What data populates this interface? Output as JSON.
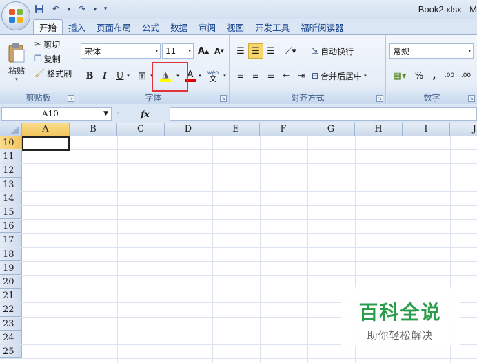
{
  "window": {
    "title": "Book2.xlsx - M"
  },
  "quick_access": {
    "save_icon": "save-icon",
    "undo_icon": "undo-icon",
    "redo_icon": "redo-icon",
    "customize": "▾"
  },
  "tabs": [
    {
      "label": "开始",
      "active": true
    },
    {
      "label": "插入"
    },
    {
      "label": "页面布局"
    },
    {
      "label": "公式"
    },
    {
      "label": "数据"
    },
    {
      "label": "审阅"
    },
    {
      "label": "视图"
    },
    {
      "label": "开发工具"
    },
    {
      "label": "福昕阅读器"
    }
  ],
  "clipboard": {
    "label": "剪贴板",
    "paste": "粘贴",
    "cut": "剪切",
    "copy": "复制",
    "format_painter": "格式刷"
  },
  "font": {
    "label": "字体",
    "name": "宋体",
    "size": "11",
    "bold": "B",
    "italic": "I",
    "underline": "U",
    "grow": "A",
    "shrink": "A",
    "font_color": "A",
    "phonetic": "wén"
  },
  "alignment": {
    "label": "对齐方式",
    "wrap": "自动换行",
    "merge": "合并后居中"
  },
  "number": {
    "label": "数字",
    "format": "常规",
    "percent": "%",
    "comma": ",",
    "inc_decimal": ".00",
    "dec_decimal": ".00"
  },
  "formula_bar": {
    "name_box": "A10",
    "fx": "fx"
  },
  "sheet": {
    "columns": [
      "A",
      "B",
      "C",
      "D",
      "E",
      "F",
      "G",
      "H",
      "I",
      "J"
    ],
    "rows": [
      "10",
      "11",
      "12",
      "13",
      "14",
      "15",
      "16",
      "17",
      "18",
      "19",
      "20",
      "21",
      "22",
      "23",
      "24",
      "25"
    ],
    "active_cell": "A10"
  },
  "watermark": {
    "title": "百科全说",
    "subtitle": "助你轻松解决"
  },
  "colors": {
    "ribbon_bg": "#e6eef8",
    "highlight": "#e0343a",
    "fill_yellow": "#ffff00",
    "font_red": "#e00000"
  }
}
